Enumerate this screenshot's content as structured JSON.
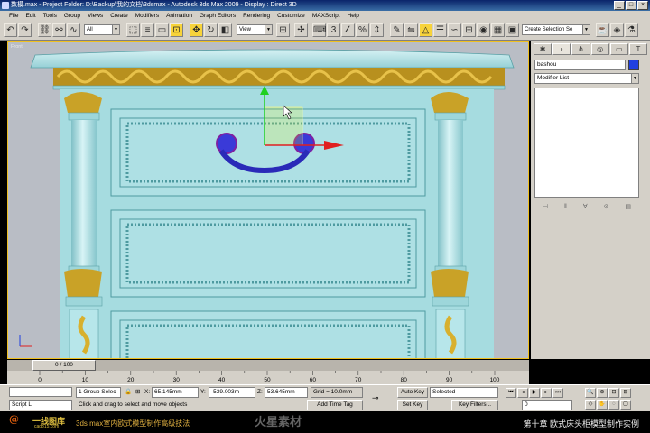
{
  "window": {
    "title": "数模.max  - Project Folder: D:\\Backup\\我的文档\\3dsmax  - Autodesk 3ds Max  2009  - Display : Direct 3D"
  },
  "menubar": {
    "items": [
      "File",
      "Edit",
      "Tools",
      "Group",
      "Views",
      "Create",
      "Modifiers",
      "Animation",
      "Graph Editors",
      "Rendering",
      "Customize",
      "MAXScript",
      "Help"
    ]
  },
  "toolbar": {
    "selection_filter": "All",
    "reference_coord": "View",
    "named_selection_placeholder": "Create Selection Se"
  },
  "viewport": {
    "label": "Front"
  },
  "command_panel": {
    "object_name": "bashou",
    "modifier_list": "Modifier List",
    "object_color": "#2040e0"
  },
  "timeline": {
    "frame_display": "0 / 100",
    "ticks": [
      "0",
      "10",
      "20",
      "30",
      "40",
      "50",
      "60",
      "70",
      "80",
      "90",
      "100"
    ]
  },
  "statusbar": {
    "selection_info": "1 Group Selec",
    "x_label": "X:",
    "x_value": "65.145mm",
    "y_label": "Y:",
    "y_value": "-539.003m",
    "z_label": "Z:",
    "z_value": "53.645mm",
    "grid_label": "Grid = 10.0mm",
    "auto_key": "Auto Key",
    "set_key": "Set Key",
    "key_mode_value": "Selected",
    "key_filters": "Key Filters...",
    "add_time_tag": "Add Time Tag",
    "prompt": "Click and drag to select and move objects",
    "maxscript_label": "Script L",
    "frame_field": "0"
  },
  "banner": {
    "logo_glyph": "@",
    "logo_name": "一线图库",
    "logo_url": "cad315.com",
    "tagline": "3ds max室内欧式模型制作高级技法",
    "watermark": "火星素材",
    "chapter": "第十章 欧式床头柜模型制作实例"
  },
  "colors": {
    "viewport_bg": "#b9bdc5",
    "cabinet": "#a6dce0",
    "gold": "#c9a227",
    "handle": "#3a3ad8",
    "active_viewport_border": "#f0c020"
  }
}
